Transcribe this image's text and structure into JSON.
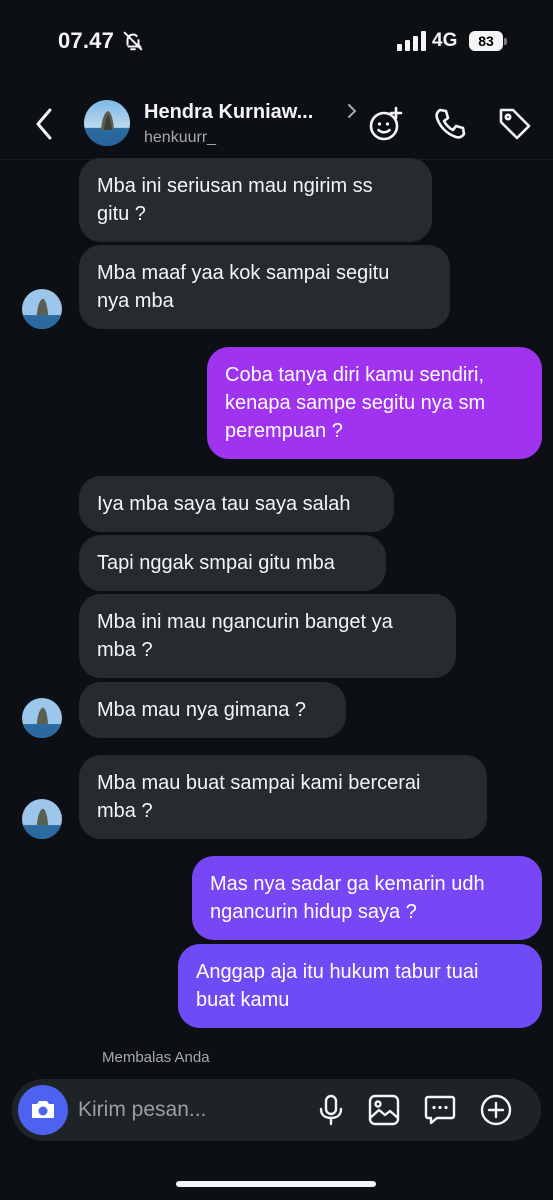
{
  "status_bar": {
    "time": "07.47",
    "network": "4G",
    "battery": "83"
  },
  "header": {
    "name": "Hendra Kurniaw...",
    "handle": "henkuurr_",
    "icons": [
      "back-icon",
      "avatar",
      "chevron-right-icon",
      "effects-icon",
      "phone-icon",
      "tag-icon"
    ]
  },
  "messages": [
    {
      "from": "them",
      "text": "Mba ini seriusan mau ngirim ss\ngitu ?"
    },
    {
      "from": "them",
      "text": "Mba maaf yaa kok sampai segitu\nnya mba"
    },
    {
      "from": "me",
      "text": "Coba tanya diri kamu sendiri,\nkenapa sampe segitu nya sm\nperempuan ?"
    },
    {
      "from": "them",
      "text": "Iya mba saya tau saya salah"
    },
    {
      "from": "them",
      "text": "Tapi nggak smpai gitu mba"
    },
    {
      "from": "them",
      "text": "Mba ini mau ngancurin banget ya\nmba ?"
    },
    {
      "from": "them",
      "text": "Mba mau nya gimana ?"
    },
    {
      "from": "them",
      "text": "Mba mau buat sampai kami bercerai\nmba ?"
    },
    {
      "from": "me",
      "text": "Mas nya sadar ga kemarin udh\nngancurin hidup saya ?"
    },
    {
      "from": "me",
      "text": "Anggap aja itu hukum tabur tuai\nbuat kamu"
    }
  ],
  "reply_note": "Membalas Anda",
  "composer": {
    "placeholder": "Kirim pesan...",
    "icons": [
      "camera-icon",
      "microphone-icon",
      "gallery-icon",
      "sticker-icon",
      "plus-icon"
    ]
  },
  "colors": {
    "background": "#0c1014",
    "incoming_bubble": "#262b30",
    "outgoing_bubble_top": "#a033f0",
    "outgoing_bubble_bottom": "#6d4cf6",
    "camera_button": "#4e62f2"
  }
}
